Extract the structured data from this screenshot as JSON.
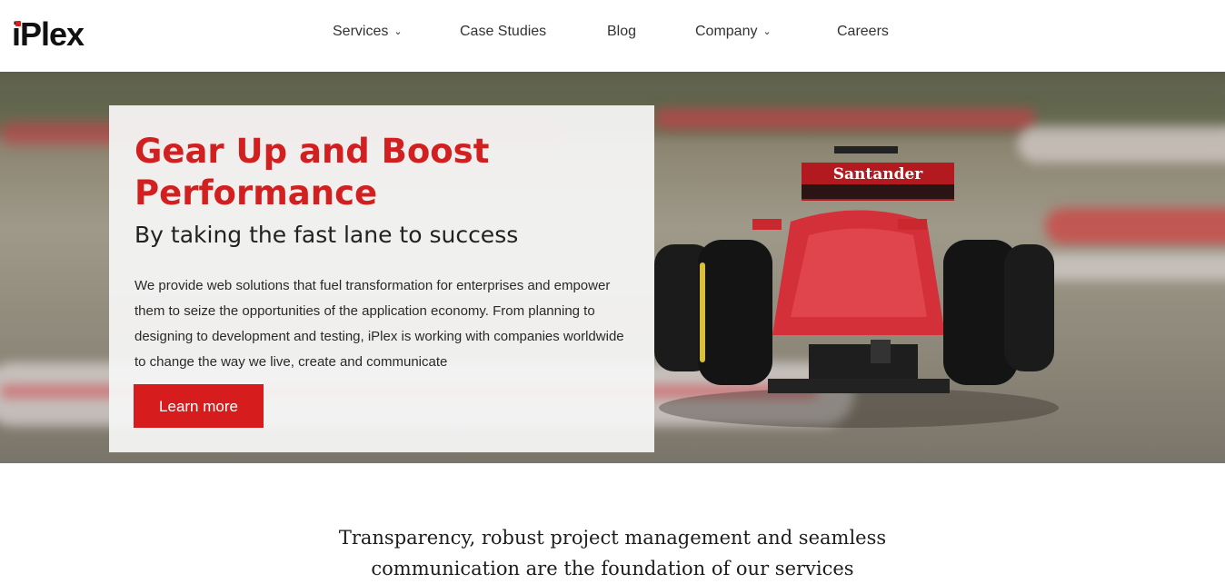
{
  "header": {
    "logo_text": "iPlex",
    "nav": [
      {
        "label": "Services",
        "has_dropdown": true
      },
      {
        "label": "Case Studies",
        "has_dropdown": false
      },
      {
        "label": "Blog",
        "has_dropdown": false
      },
      {
        "label": "Company",
        "has_dropdown": true
      },
      {
        "label": "Careers",
        "has_dropdown": false
      }
    ],
    "dropdown_icon": "chevron-down-icon"
  },
  "hero": {
    "title": "Gear Up and Boost Performance",
    "subtitle": "By taking the fast lane to success",
    "body": "We provide web solutions that fuel transformation for enterprises and empower them to seize the opportunities of the application economy. From planning to designing to development and testing, iPlex is working with companies worldwide to change the way we live, create and communicate",
    "cta_label": "Learn more",
    "car_sponsor_text": "Santander"
  },
  "intro": {
    "line1": "Transparency, robust project management and seamless",
    "line2": "communication are the foundation of our services"
  },
  "colors": {
    "accent": "#d61c1c",
    "text": "#222222",
    "panel_bg": "#f5f5f5"
  }
}
